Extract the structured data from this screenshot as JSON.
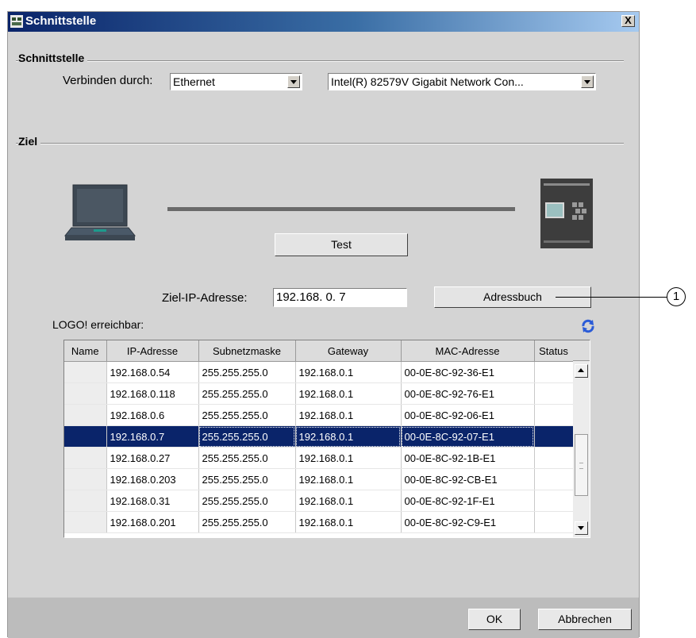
{
  "window": {
    "title": "Schnittstelle",
    "close_glyph": "X",
    "app_icon": "logo-app-icon"
  },
  "interface_section": {
    "label": "Schnittstelle",
    "connect_via_label": "Verbinden durch:",
    "connect_via_value": "Ethernet",
    "adapter_value": "Intel(R) 82579V Gigabit Network Con..."
  },
  "target_section": {
    "label": "Ziel",
    "pc_icon": "laptop-icon",
    "device_icon": "logo-device-icon",
    "test_button": "Test",
    "ip_label": "Ziel-IP-Adresse:",
    "ip_value": "192.168. 0. 7",
    "addressbook_button": "Adressbuch",
    "callout_number": "1"
  },
  "reachable": {
    "label": "LOGO! erreichbar:",
    "refresh_icon": "refresh-icon",
    "columns": [
      "Name",
      "IP-Adresse",
      "Subnetzmaske",
      "Gateway",
      "MAC-Adresse",
      "Status"
    ],
    "rows": [
      {
        "name": "",
        "ip": "192.168.0.54",
        "mask": "255.255.255.0",
        "gw": "192.168.0.1",
        "mac": "00-0E-8C-92-36-E1",
        "status": ""
      },
      {
        "name": "",
        "ip": "192.168.0.118",
        "mask": "255.255.255.0",
        "gw": "192.168.0.1",
        "mac": "00-0E-8C-92-76-E1",
        "status": ""
      },
      {
        "name": "",
        "ip": "192.168.0.6",
        "mask": "255.255.255.0",
        "gw": "192.168.0.1",
        "mac": "00-0E-8C-92-06-E1",
        "status": ""
      },
      {
        "name": "",
        "ip": "192.168.0.7",
        "mask": "255.255.255.0",
        "gw": "192.168.0.1",
        "mac": "00-0E-8C-92-07-E1",
        "status": ""
      },
      {
        "name": "",
        "ip": "192.168.0.27",
        "mask": "255.255.255.0",
        "gw": "192.168.0.1",
        "mac": "00-0E-8C-92-1B-E1",
        "status": ""
      },
      {
        "name": "",
        "ip": "192.168.0.203",
        "mask": "255.255.255.0",
        "gw": "192.168.0.1",
        "mac": "00-0E-8C-92-CB-E1",
        "status": ""
      },
      {
        "name": "",
        "ip": "192.168.0.31",
        "mask": "255.255.255.0",
        "gw": "192.168.0.1",
        "mac": "00-0E-8C-92-1F-E1",
        "status": ""
      },
      {
        "name": "",
        "ip": "192.168.0.201",
        "mask": "255.255.255.0",
        "gw": "192.168.0.1",
        "mac": "00-0E-8C-92-C9-E1",
        "status": ""
      }
    ]
  },
  "footer": {
    "ok_button": "OK",
    "cancel_button": "Abbrechen"
  },
  "colors": {
    "selection": "#0a246a",
    "titlebar": "#0a246a",
    "refresh": "#2a5bd7"
  }
}
